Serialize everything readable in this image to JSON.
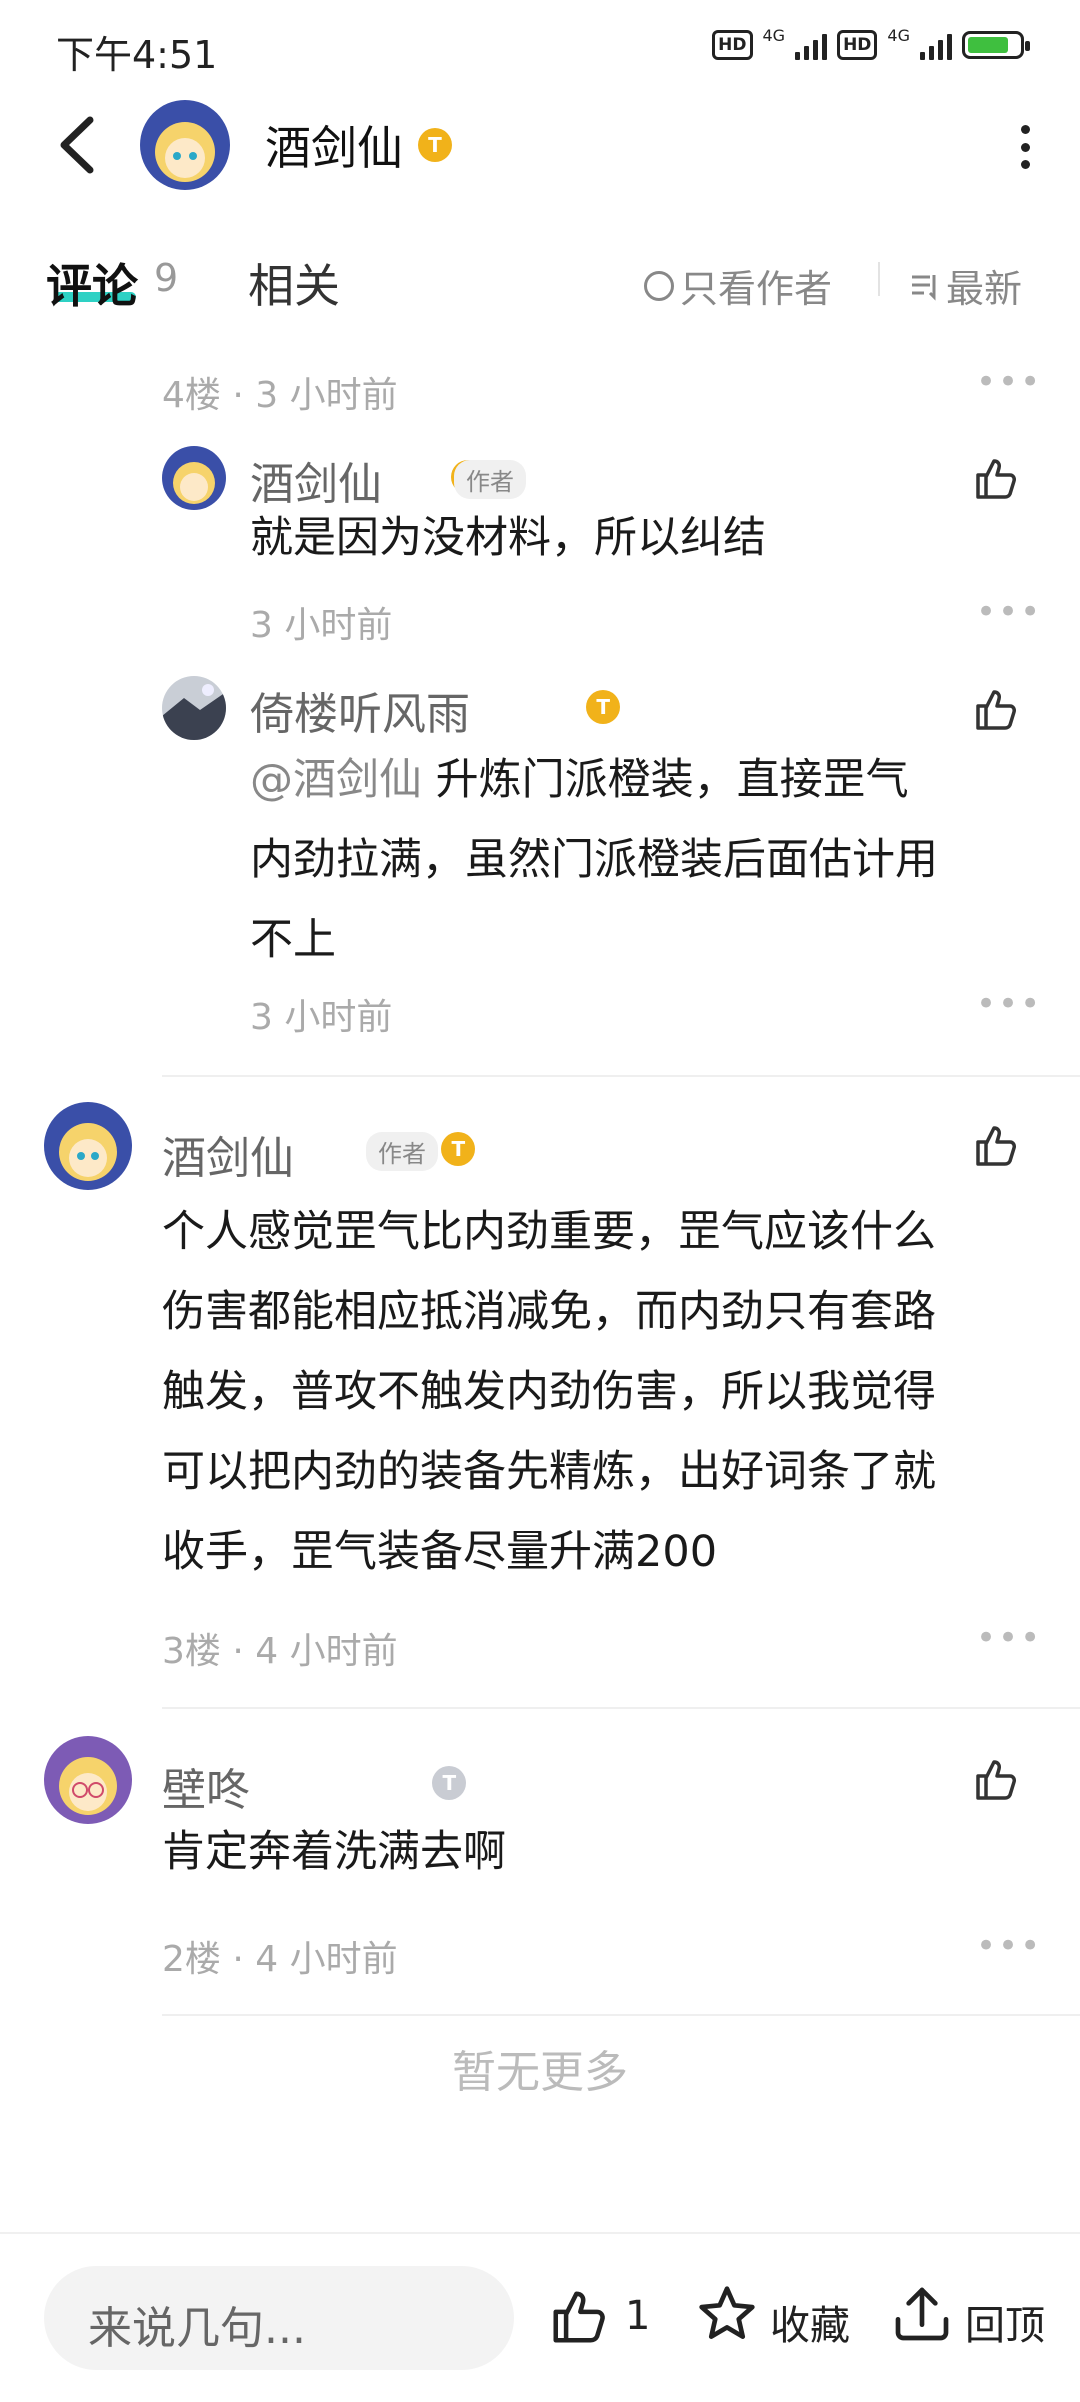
{
  "status_bar": {
    "time": "下午4:51",
    "hd1": "HD",
    "net1": "4G",
    "hd2": "HD",
    "net2": "4G"
  },
  "header": {
    "title": "酒剑仙",
    "badge": "T"
  },
  "tabs": {
    "comments": "评论",
    "comments_count": "9",
    "related": "相关",
    "only_author": "只看作者",
    "sort": "最新"
  },
  "thread4": {
    "floor_meta": "4楼 · 3 小时前",
    "replies": [
      {
        "name": "酒剑仙",
        "author_tag": "作者",
        "text": "就是因为没材料，所以纠结",
        "time": "3 小时前"
      },
      {
        "name": "倚楼听风雨",
        "mention": "@酒剑仙",
        "text_line1": "升炼门派橙装，直接罡气",
        "text_line2": "内劲拉满，虽然门派橙装后面估计用",
        "text_line3": "不上",
        "time": "3 小时前"
      }
    ]
  },
  "comment3": {
    "name": "酒剑仙",
    "author_tag": "作者",
    "lines": [
      "个人感觉罡气比内劲重要，罡气应该什么",
      "伤害都能相应抵消减免，而内劲只有套路",
      "触发，普攻不触发内劲伤害，所以我觉得",
      "可以把内劲的装备先精炼，出好词条了就",
      "收手，罡气装备尽量升满200"
    ],
    "meta": "3楼 · 4 小时前"
  },
  "comment2": {
    "name": "壁咚",
    "text": "肯定奔着洗满去啊",
    "meta": "2楼 · 4 小时前"
  },
  "no_more": "暂无更多",
  "bottom": {
    "placeholder": "来说几句...",
    "like_count": "1",
    "favorite": "收藏",
    "back_top": "回顶"
  },
  "colors": {
    "accent": "#2ed1c4",
    "badge_gold": "#f1b21a",
    "badge_silver": "#c9ccd3"
  }
}
